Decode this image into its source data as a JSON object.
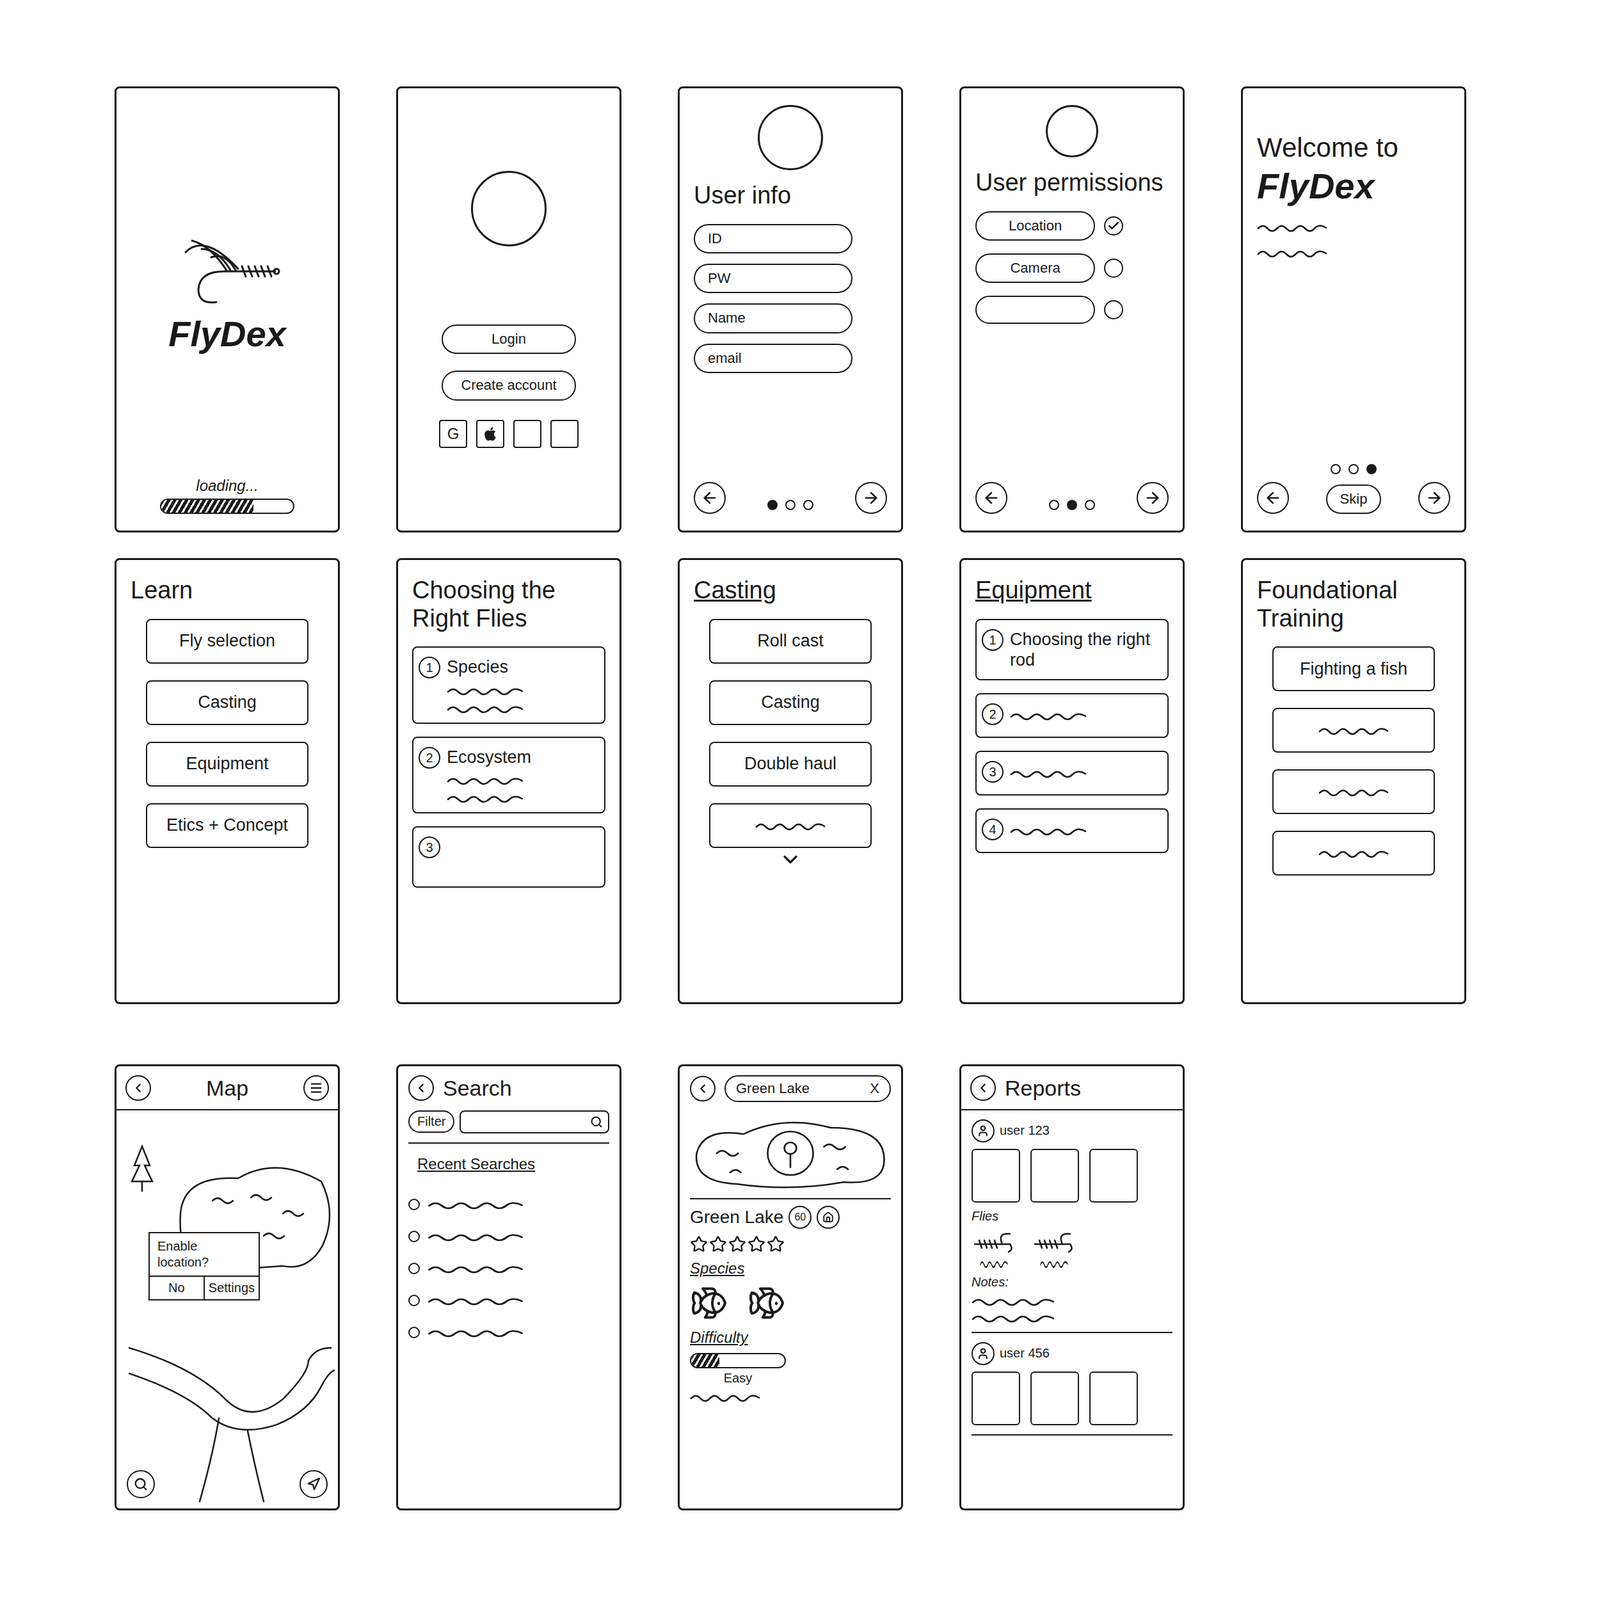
{
  "screens": [
    {
      "kind": "splash",
      "brand": "FlyDex",
      "loading": "loading...",
      "level": 0.7
    },
    {
      "kind": "login",
      "buttons": [
        "Login",
        "Create account"
      ],
      "providers": [
        {
          "kind": "google",
          "label": "G"
        },
        {
          "kind": "apple",
          "label": ""
        },
        {
          "kind": "blank",
          "label": ""
        },
        {
          "kind": "blank",
          "label": ""
        }
      ]
    },
    {
      "kind": "user-info",
      "title": "User info",
      "fields": [
        "ID",
        "PW",
        "Name",
        "email"
      ],
      "pages": [
        {
          "selected": true
        },
        {
          "selected": false
        },
        {
          "selected": false
        }
      ]
    },
    {
      "kind": "permissions",
      "title": "User permissions",
      "permissions": [
        {
          "label": "Location",
          "checked": true
        },
        {
          "label": "Camera",
          "checked": false
        },
        {
          "label": "",
          "checked": false
        }
      ],
      "pages": [
        {
          "selected": false
        },
        {
          "selected": true
        },
        {
          "selected": false
        }
      ]
    },
    {
      "kind": "welcome",
      "title": "Welcome to",
      "brand": "FlyDex",
      "lines": 2,
      "skip": "Skip",
      "pages": [
        {
          "selected": false
        },
        {
          "selected": false
        },
        {
          "selected": true
        }
      ]
    },
    {
      "kind": "menu",
      "title": "Learn",
      "underlined": false,
      "more": false,
      "items": [
        {
          "label": "Fly selection",
          "lines": 0
        },
        {
          "label": "Casting",
          "lines": 0
        },
        {
          "label": "Equipment",
          "lines": 0
        },
        {
          "label": "Etics + Concept",
          "lines": 0
        }
      ]
    },
    {
      "kind": "sections",
      "title": "Choosing the Right Flies",
      "underlined": false,
      "items": [
        {
          "number": "1",
          "label": "Species",
          "lines": 2
        },
        {
          "number": "2",
          "label": "Ecosystem",
          "lines": 2
        },
        {
          "number": "3",
          "label": "",
          "lines": 0
        }
      ]
    },
    {
      "kind": "menu",
      "title": "Casting",
      "underlined": true,
      "more": true,
      "items": [
        {
          "label": "Roll cast",
          "lines": 0
        },
        {
          "label": "Casting",
          "lines": 0
        },
        {
          "label": "Double haul",
          "lines": 0
        },
        {
          "label": "",
          "lines": 1
        }
      ]
    },
    {
      "kind": "sections",
      "title": "Equipment",
      "underlined": true,
      "items": [
        {
          "number": "1",
          "label": "Choosing the right rod",
          "lines": 0
        },
        {
          "number": "2",
          "label": "",
          "lines": 1
        },
        {
          "number": "3",
          "label": "",
          "lines": 1
        },
        {
          "number": "4",
          "label": "",
          "lines": 1
        }
      ]
    },
    {
      "kind": "menu",
      "title": "Foundational Training",
      "underlined": false,
      "more": false,
      "items": [
        {
          "label": "Fighting a fish",
          "lines": 0
        },
        {
          "label": "",
          "lines": 1
        },
        {
          "label": "",
          "lines": 1
        },
        {
          "label": "",
          "lines": 1
        }
      ]
    },
    {
      "kind": "map",
      "title": "Map",
      "dialog": {
        "message": "Enable location?",
        "buttons": [
          "No",
          "Settings"
        ]
      }
    },
    {
      "kind": "search",
      "title": "Search",
      "filter": "Filter",
      "recent_title": "Recent Searches",
      "recent": [
        {
          "lines": 1
        },
        {
          "lines": 1
        },
        {
          "lines": 1
        },
        {
          "lines": 1
        },
        {
          "lines": 1
        }
      ]
    },
    {
      "kind": "spot",
      "query": "Green Lake",
      "close": "X",
      "name": "Green Lake",
      "badge": "60",
      "stars": 0,
      "star_total": 5,
      "species_title": "Species",
      "species_count": 2,
      "difficulty_title": "Difficulty",
      "difficulty": {
        "level": 0.3,
        "label": "Easy"
      }
    },
    {
      "kind": "reports",
      "title": "Reports",
      "reports": [
        {
          "user": "user 123",
          "photos": 3,
          "flies_title": "Flies",
          "flies": 2,
          "notes_title": "Notes:",
          "notes_lines": 2
        },
        {
          "user": "user 456",
          "photos": 3,
          "flies_title": "",
          "flies": 0,
          "notes_title": "",
          "notes_lines": 0
        }
      ]
    }
  ]
}
